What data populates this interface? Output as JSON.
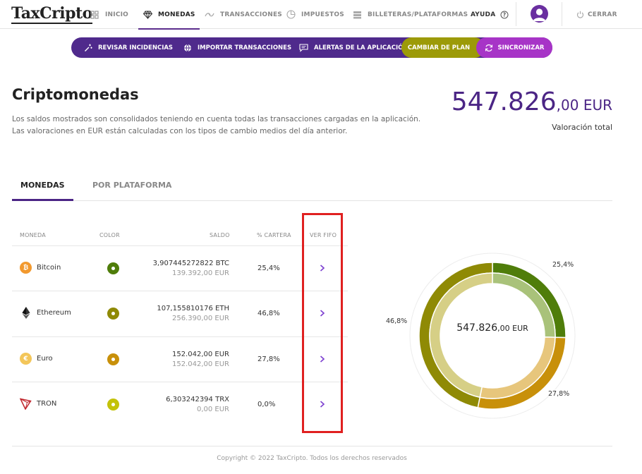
{
  "app": {
    "logo": "TaxCripto"
  },
  "nav": {
    "items": [
      {
        "label": "INICIO",
        "icon": "grid-icon"
      },
      {
        "label": "MONEDAS",
        "icon": "diamond-icon"
      },
      {
        "label": "TRANSACCIONES",
        "icon": "transfer-icon"
      },
      {
        "label": "IMPUESTOS",
        "icon": "pie-icon"
      },
      {
        "label": "BILLETERAS/PLATAFORMAS",
        "icon": "wallet-icon"
      }
    ],
    "help": "AYUDA",
    "logout": "CERRAR"
  },
  "actions": {
    "review": "REVISAR INCIDENCIAS",
    "import": "IMPORTAR TRANSACCIONES",
    "alerts": "ALERTAS DE LA APLICACIÓN",
    "plan": "CAMBIAR DE PLAN",
    "sync": "SINCRONIZAR"
  },
  "page": {
    "title": "Criptomonedas",
    "desc1": "Los saldos mostrados son consolidados teniendo en cuenta todas las transacciones cargadas en la aplicación.",
    "desc2": "Las valoraciones en EUR están calculadas con los tipos de cambio medios del día anterior.",
    "total_int": "547.826",
    "total_dec": ",00 EUR",
    "total_label": "Valoración total"
  },
  "tabs": {
    "coins": "MONEDAS",
    "platform": "POR PLATAFORMA"
  },
  "table": {
    "headers": {
      "coin": "MONEDA",
      "color": "COLOR",
      "balance": "SALDO",
      "pct": "% CARTERA",
      "fifo": "VER FIFO"
    },
    "rows": [
      {
        "name": "Bitcoin",
        "amount": "3,907445272822 BTC",
        "eur": "139.392,00 EUR",
        "pct": "25,4%"
      },
      {
        "name": "Ethereum",
        "amount": "107,155810176 ETH",
        "eur": "256.390,00 EUR",
        "pct": "46,8%"
      },
      {
        "name": "Euro",
        "amount": "152.042,00 EUR",
        "eur": "152.042,00 EUR",
        "pct": "27,8%"
      },
      {
        "name": "TRON",
        "amount": "6,303242394 TRX",
        "eur": "0,00 EUR",
        "pct": "0,0%"
      }
    ]
  },
  "colors": {
    "bitcoin": "#4f7d0a",
    "ethereum": "#8f8a05",
    "euro": "#c8900a",
    "tron": "#c3c20a",
    "accent": "#4b2585"
  },
  "chart_data": {
    "type": "pie",
    "categories": [
      "Bitcoin",
      "Euro",
      "Ethereum"
    ],
    "values": [
      25.4,
      27.8,
      46.8
    ],
    "value_labels": [
      "25,4%",
      "27,8%",
      "46,8%"
    ],
    "center_int": "547.826",
    "center_dec": ",00 EUR"
  },
  "footer": {
    "copyright": "Copyright © 2022 TaxCripto. Todos los derechos reservados"
  }
}
